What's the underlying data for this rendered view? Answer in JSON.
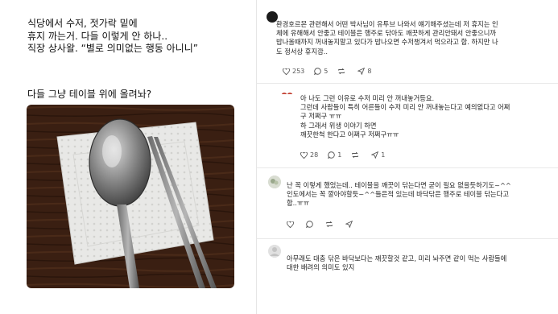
{
  "post": {
    "lines": [
      "식당에서 수저, 젓가락 밑에",
      "휴지 까는거. 다들 이렇게 안 하나..",
      "직장 상사왈. “별로 의미없는 행동 아니니”"
    ],
    "question": "다들 그냥 테이블 위에 올려놔?"
  },
  "comments": [
    {
      "lines": [
        "환경호르몬 관련해서 어떤 박사님이 유투브 나와서 얘기해주셨는데 저 휴지는 인",
        "체에 유해해서 안좋고 테이블은 행주로 닦아도 깨끗하게 관리안돼서 안좋으니까",
        "밥나올때까지 꺼내놓지말고 있다가 밥나오면 수저챙겨서 먹으라고 함. 하지만 나",
        "도 정서상 휴지깜.."
      ],
      "likes": "253",
      "replies": "5",
      "reposts": "",
      "shares": "8"
    },
    {
      "lines": [
        "아 나도 그런 이유로 수저 미리 안 꺼내놓거등요.",
        "그런데 사람들이 특히 어른들이 수저 미리 안 꺼내놓는다고 예의없다고 어쩌",
        "구 저쩌구 ㅠㅠ",
        "하 그래서 위생 이야기 하면",
        "깨끗한척 한다고 어쩌구 저쩌구ㅠㅠ"
      ],
      "likes": "28",
      "replies": "1",
      "reposts": "",
      "shares": "1"
    },
    {
      "lines": [
        "난 꼭 이렇게 했었는데.. 테이블을 깨끗이 닦는다면 굳이 필요 없을듯하기도~^^",
        "인도에서는 꼭 깔아야할듯~^^들은적 있는데 바닥닦은 행주로 테이블 닦는다고",
        "함..ㅠㅠ"
      ],
      "likes": "",
      "replies": "",
      "reposts": "",
      "shares": ""
    },
    {
      "lines": [
        "아무래도 대충 닦은 바닥보다는 깨끗할것 같고, 미리 놔주면 같이 먹는 사람들에",
        "대한 배려의 의미도 있지"
      ]
    }
  ],
  "colors": {
    "like": "#6b6b6b",
    "avatar_red": "#c0392b"
  }
}
